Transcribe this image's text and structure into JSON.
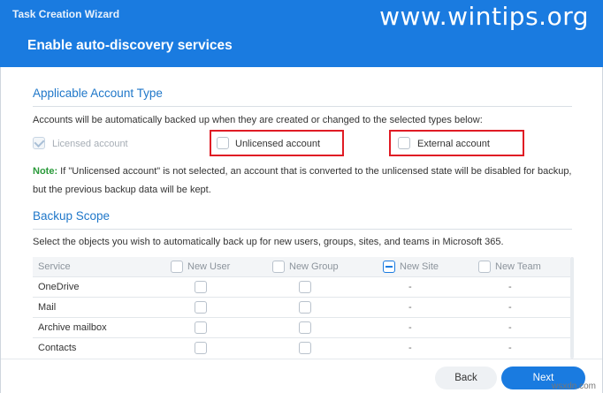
{
  "window": {
    "title": "Task Creation Wizard",
    "watermark": "www.wintips.org"
  },
  "wizard": {
    "title": "Enable auto-discovery services"
  },
  "account_type": {
    "title": "Applicable Account Type",
    "description": "Accounts will be automatically backed up when they are created or changed to the selected types below:",
    "options": [
      {
        "label": "Licensed account",
        "checked": true,
        "disabled": true
      },
      {
        "label": "Unlicensed account",
        "checked": false
      },
      {
        "label": "External account",
        "checked": false
      }
    ],
    "note_key": "Note:",
    "note_text": "If \"Unlicensed account\" is not selected, an account that is converted to the unlicensed state will be disabled for backup, but the previous backup data will be kept."
  },
  "backup_scope": {
    "title": "Backup Scope",
    "description": "Select the objects you wish to automatically back up for new users, groups, sites, and teams in Microsoft 365.",
    "columns": [
      "Service",
      "New User",
      "New Group",
      "New Site",
      "New Team"
    ],
    "rows": [
      {
        "service": "OneDrive",
        "site": "-",
        "team": "-"
      },
      {
        "service": "Mail",
        "site": "-",
        "team": "-"
      },
      {
        "service": "Archive mailbox",
        "site": "-",
        "team": "-"
      },
      {
        "service": "Contacts",
        "site": "-",
        "team": "-"
      }
    ]
  },
  "footer": {
    "back_label": "Back",
    "next_label": "Next",
    "site_mark": "wsxdn.com"
  },
  "colors": {
    "accent": "#1a7be0",
    "highlight": "#e01b24",
    "note": "#2a9a3a"
  }
}
